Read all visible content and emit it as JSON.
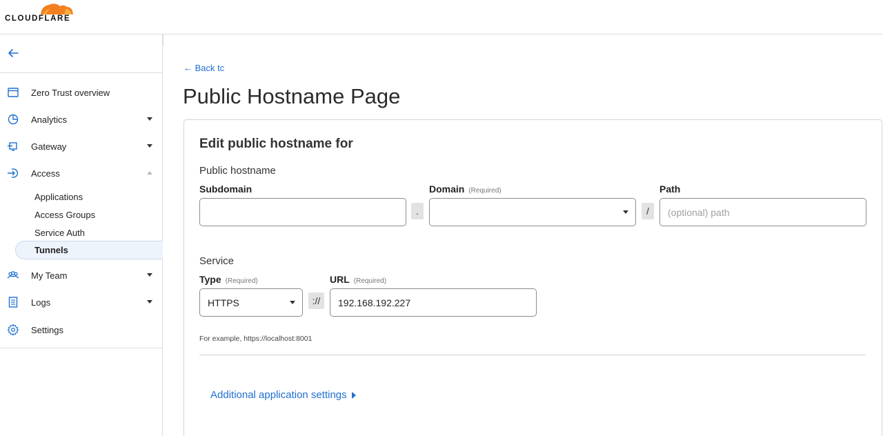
{
  "brand": {
    "name": "CLOUDFLARE",
    "accent": "#f38020"
  },
  "sidebar": {
    "back_icon": "arrow-left-icon",
    "items": [
      {
        "label": "Zero Trust overview",
        "icon": "window-icon"
      },
      {
        "label": "Analytics",
        "icon": "pie-chart-icon",
        "caret": "down"
      },
      {
        "label": "Gateway",
        "icon": "gateway-icon",
        "caret": "down"
      },
      {
        "label": "Access",
        "icon": "sign-in-icon",
        "caret": "up"
      },
      {
        "label": "My Team",
        "icon": "users-icon",
        "caret": "down"
      },
      {
        "label": "Logs",
        "icon": "document-icon",
        "caret": "down"
      },
      {
        "label": "Settings",
        "icon": "gear-icon"
      }
    ],
    "access_subitems": [
      {
        "label": "Applications"
      },
      {
        "label": "Access Groups"
      },
      {
        "label": "Service Auth"
      },
      {
        "label": "Tunnels",
        "active": true
      }
    ]
  },
  "main": {
    "back_link": "← Back tc",
    "title": "Public Hostname Page",
    "card": {
      "title": "Edit public hostname for",
      "public_hostname_label": "Public hostname",
      "subdomain": {
        "label": "Subdomain",
        "value": ""
      },
      "dot_separator": ".",
      "domain": {
        "label": "Domain",
        "required": "(Required)",
        "value": ""
      },
      "slash_separator": "/",
      "path": {
        "label": "Path",
        "placeholder": "(optional) path"
      },
      "service_label": "Service",
      "type": {
        "label": "Type",
        "required": "(Required)",
        "value": "HTTPS"
      },
      "scheme_separator": "://",
      "url": {
        "label": "URL",
        "required": "(Required)",
        "value": "192.168.192.227"
      },
      "help": "For example, https://localhost:8001",
      "additional_settings": "Additional application settings"
    }
  },
  "colors": {
    "link": "#1f6fd1",
    "active_bg": "#eef4fb"
  }
}
